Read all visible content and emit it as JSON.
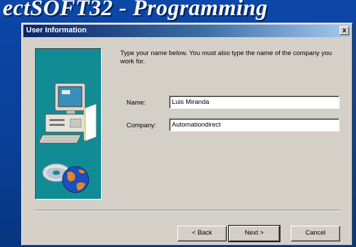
{
  "background": {
    "title": "ectSOFT32 - Programming"
  },
  "dialog": {
    "title": "User Information",
    "close_label": "x",
    "instructions": "Type your name below. You must also type the name of the company you work for.",
    "fields": {
      "name_label": "Name:",
      "name_value": "Luis Miranda",
      "company_label": "Company:",
      "company_value": "Automationdirect"
    },
    "buttons": {
      "back": "< Back",
      "next": "Next >",
      "cancel": "Cancel"
    }
  },
  "icons": {
    "computer": "computer-icon",
    "cd": "cd-icon",
    "globe": "globe-icon"
  },
  "colors": {
    "backdrop": "#0a3f96",
    "titlebar_start": "#0a246a",
    "titlebar_end": "#a6caf0",
    "art_panel": "#128c94",
    "dialog_face": "#d4d0c8"
  }
}
